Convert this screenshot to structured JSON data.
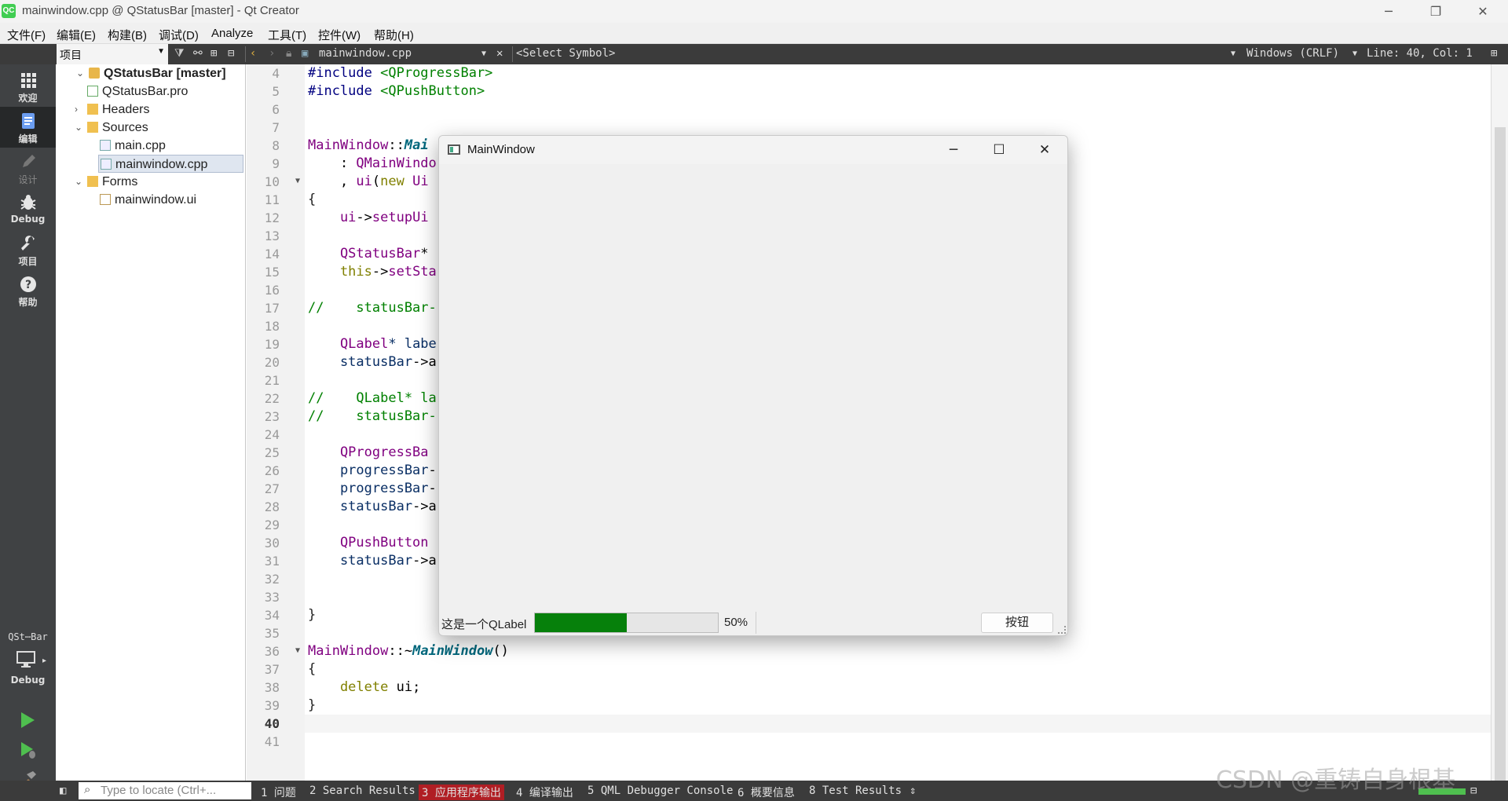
{
  "window": {
    "title": "mainwindow.cpp @ QStatusBar [master] - Qt Creator",
    "logo": "QC",
    "controls": [
      "─",
      "❐",
      "✕"
    ]
  },
  "menu": [
    "文件(F)",
    "编辑(E)",
    "构建(B)",
    "调试(D)",
    "Analyze",
    "工具(T)",
    "控件(W)",
    "帮助(H)"
  ],
  "toolbar": {
    "project_combo": "项目",
    "file_name": "mainwindow.cpp",
    "symbol": "<Select Symbol>",
    "line_ending": "Windows (CRLF)",
    "position": "Line: 40, Col: 1"
  },
  "modes": [
    {
      "label": "欢迎",
      "icon": "grid-icon"
    },
    {
      "label": "编辑",
      "icon": "edit-doc-icon"
    },
    {
      "label": "设计",
      "icon": "pencil-icon"
    },
    {
      "label": "Debug",
      "icon": "bug-icon"
    },
    {
      "label": "项目",
      "icon": "wrench-icon"
    },
    {
      "label": "帮助",
      "icon": "help-icon"
    }
  ],
  "kit": {
    "name": "QSt⋯Bar",
    "mode": "Debug"
  },
  "tree": [
    {
      "label": "QStatusBar [master]",
      "arrow": "⌄",
      "bold": true
    },
    {
      "label": "QStatusBar.pro"
    },
    {
      "label": "Headers",
      "arrow": "›"
    },
    {
      "label": "Sources",
      "arrow": "⌄"
    },
    {
      "label": "main.cpp"
    },
    {
      "label": "mainwindow.cpp",
      "selected": true
    },
    {
      "label": "Forms",
      "arrow": "⌄"
    },
    {
      "label": "mainwindow.ui"
    }
  ],
  "editor": {
    "line_numbers": [
      "4",
      "5",
      "6",
      "7",
      "8",
      "9",
      "10",
      "11",
      "12",
      "13",
      "14",
      "15",
      "16",
      "17",
      "18",
      "19",
      "20",
      "21",
      "22",
      "23",
      "24",
      "25",
      "26",
      "27",
      "28",
      "29",
      "30",
      "31",
      "32",
      "33",
      "34",
      "35",
      "36",
      "37",
      "38",
      "39",
      "40",
      "41"
    ],
    "current_line": "40",
    "lines": {
      "l4a": "#include ",
      "l4b": "<QProgressBar>",
      "l5a": "#include ",
      "l5b": "<QPushButton>",
      "l8a": "MainWindow",
      "l8b": "::",
      "l8c": "Mai",
      "l9a": "    : ",
      "l9b": "QMainWindo",
      "l10a": "    , ",
      "l10b": "ui",
      "l10c": "(",
      "l10d": "new",
      "l10e": " Ui",
      "l11": "{",
      "l12a": "    ui",
      "l12b": "->",
      "l12c": "setupUi",
      "l14a": "    QStatusBar",
      "l14b": "*",
      "l15a": "    this",
      "l15b": "->",
      "l15c": "setSta",
      "l17": "//    statusBar-",
      "l19a": "    QLabel",
      "l19b": "* labe",
      "l20a": "    statusBar",
      "l20b": "->a",
      "l22": "//    QLabel* la",
      "l23": "//    statusBar-",
      "l25": "    QProgressBa",
      "l26a": "    progressBar",
      "l26b": "-",
      "l27a": "    progressBar",
      "l27b": "-",
      "l28a": "    statusBar",
      "l28b": "->a",
      "l30": "    QPushButton",
      "l31a": "    statusBar",
      "l31b": "->a",
      "l34": "}",
      "l36a": "MainWindow",
      "l36b": "::~",
      "l36c": "MainWindow",
      "l36d": "()",
      "l37": "{",
      "l38a": "    delete",
      "l38b": " ui;",
      "l39": "}"
    }
  },
  "app_window": {
    "title": "MainWindow",
    "label": "这是一个QLabel",
    "progress": 0.5,
    "progress_text": "50%",
    "button": "按钮",
    "progress_color": "#06800b"
  },
  "bottom": {
    "locator_placeholder": "Type to locate (Ctrl+...",
    "panes": [
      "1 问题",
      "2 Search Results",
      "3 应用程序输出",
      "4 编译输出",
      "5 QML Debugger Console",
      "6 概要信息",
      "8 Test Results"
    ]
  },
  "watermark": "CSDN @重铸自身根基"
}
